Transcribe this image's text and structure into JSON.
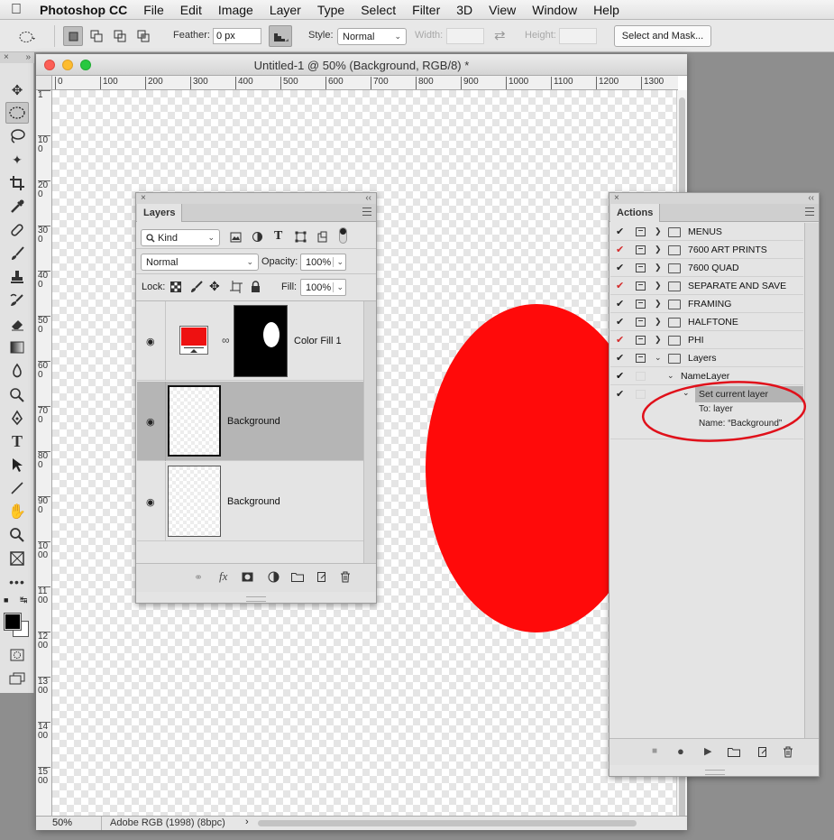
{
  "menubar": {
    "items": [
      "Photoshop CC",
      "File",
      "Edit",
      "Image",
      "Layer",
      "Type",
      "Select",
      "Filter",
      "3D",
      "View",
      "Window",
      "Help"
    ]
  },
  "options": {
    "feather_label": "Feather:",
    "feather_value": "0 px",
    "style_label": "Style:",
    "style_value": "Normal",
    "width_label": "Width:",
    "height_label": "Height:",
    "select_mask_label": "Select and Mask..."
  },
  "document": {
    "title": "Untitled-1 @ 50% (Background, RGB/8) *",
    "zoom": "50%",
    "color_profile": "Adobe RGB (1998) (8bpc)",
    "ruler_h": [
      "0",
      "100",
      "200",
      "300",
      "400",
      "500",
      "600",
      "700",
      "800",
      "900",
      "1000",
      "1100",
      "1200",
      "1300"
    ],
    "ruler_v": [
      "1",
      "100",
      "200",
      "300",
      "400",
      "500",
      "600",
      "700",
      "800",
      "900",
      "1000",
      "1100",
      "1200",
      "1300",
      "1400",
      "1500"
    ],
    "ellipse_color": "#ff0a0a"
  },
  "layers_panel": {
    "tab": "Layers",
    "filter_kind": "Kind",
    "blend_mode": "Normal",
    "opacity_label": "Opacity:",
    "opacity_value": "100%",
    "lock_label": "Lock:",
    "fill_label": "Fill:",
    "fill_value": "100%",
    "layers": [
      {
        "name": "Color Fill 1",
        "selected": false,
        "fill_color": "#ee1111"
      },
      {
        "name": "Background",
        "selected": true
      },
      {
        "name": "Background",
        "selected": false
      }
    ]
  },
  "actions_panel": {
    "tab": "Actions",
    "items": [
      {
        "name": "MENUS",
        "check_color": "#222222"
      },
      {
        "name": "7600 ART PRINTS",
        "check_color": "#d42a2a"
      },
      {
        "name": "7600 QUAD",
        "check_color": "#222222"
      },
      {
        "name": "SEPARATE AND SAVE",
        "check_color": "#d42a2a"
      },
      {
        "name": "FRAMING",
        "check_color": "#222222"
      },
      {
        "name": "HALFTONE",
        "check_color": "#222222"
      },
      {
        "name": "PHI",
        "check_color": "#d42a2a"
      },
      {
        "name": "Layers",
        "check_color": "#222222"
      }
    ],
    "sub_action": "NameLayer",
    "step": "Set current layer",
    "step_to": "To: layer",
    "step_name": "Name:  “Background”",
    "highlight_color": "#e0101a"
  }
}
